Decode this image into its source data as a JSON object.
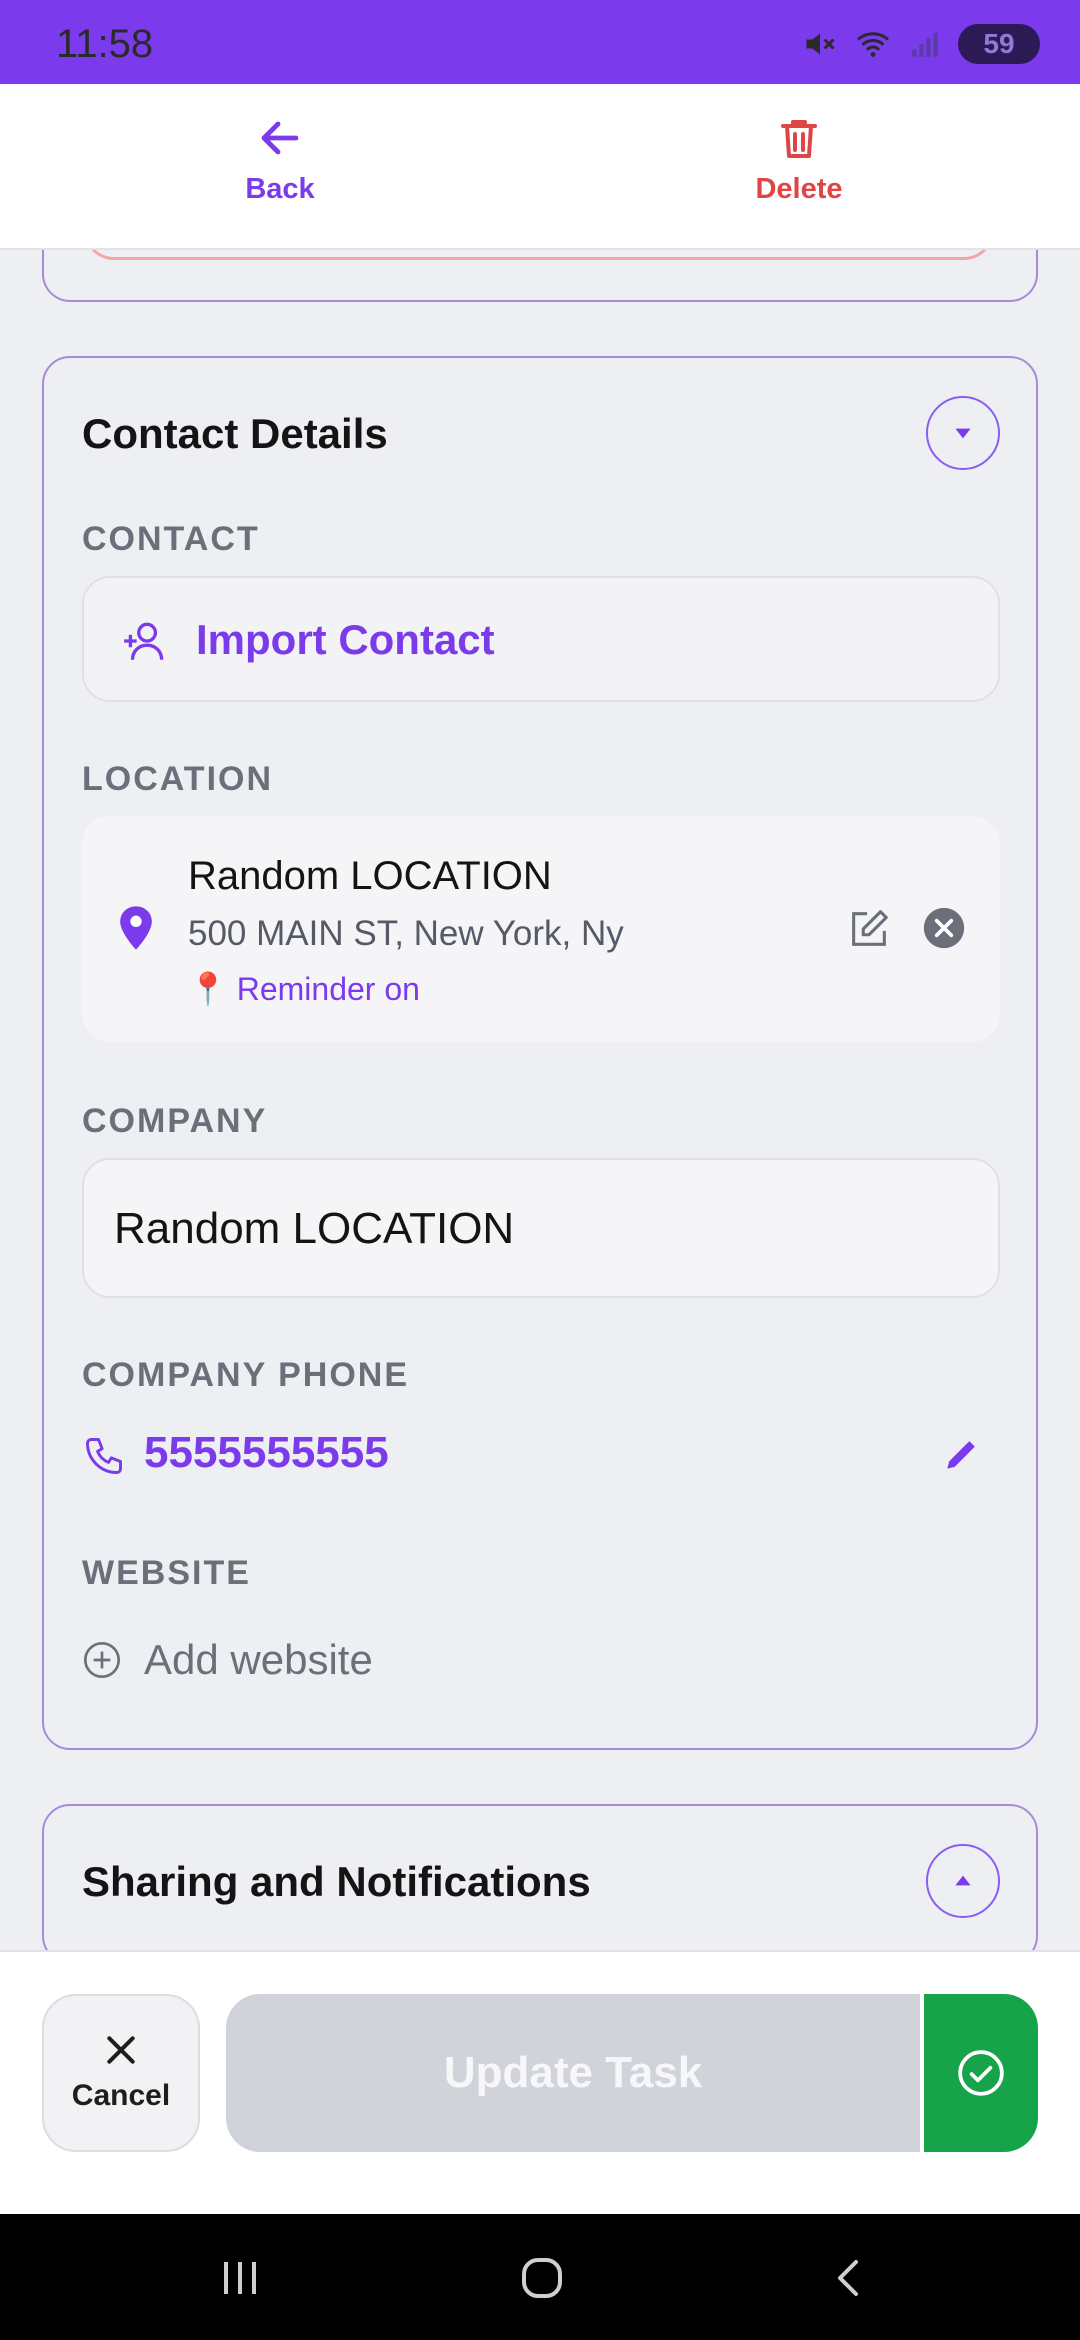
{
  "status_bar": {
    "time": "11:58",
    "battery": "59"
  },
  "top_nav": {
    "back_label": "Back",
    "delete_label": "Delete"
  },
  "contact_card": {
    "title": "Contact Details",
    "contact_label": "CONTACT",
    "import_label": "Import Contact",
    "location_label": "LOCATION",
    "location": {
      "name": "Random LOCATION",
      "address": "500 MAIN ST, New York, Ny",
      "reminder": "📍 Reminder on"
    },
    "company_label": "COMPANY",
    "company_value": "Random LOCATION",
    "company_phone_label": "COMPANY PHONE",
    "company_phone_value": "5555555555",
    "website_label": "WEBSITE",
    "website_placeholder": "Add website"
  },
  "sharing_card": {
    "title": "Sharing and Notifications"
  },
  "action_bar": {
    "cancel_label": "Cancel",
    "update_label": "Update Task"
  },
  "colors": {
    "accent": "#7c3aed",
    "danger": "#e04545",
    "success": "#16a34a"
  }
}
